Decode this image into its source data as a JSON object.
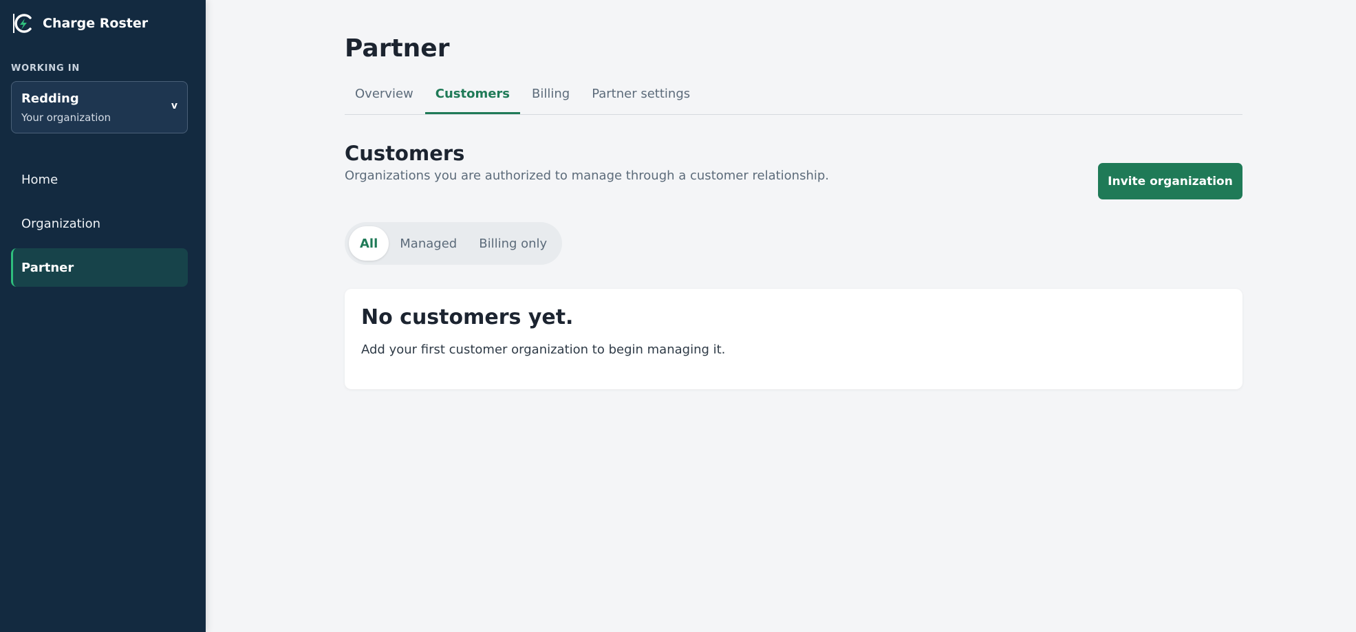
{
  "brand": {
    "name": "Charge Roster",
    "logo_icon": "lightning-bolt-icon",
    "accent_color": "#2fbf7d"
  },
  "sidebar": {
    "working_in_label": "WORKING IN",
    "org_switcher": {
      "name": "Redding",
      "subtitle": "Your organization",
      "chevron": "v"
    },
    "items": [
      {
        "label": "Home",
        "active": false
      },
      {
        "label": "Organization",
        "active": false
      },
      {
        "label": "Partner",
        "active": true
      }
    ]
  },
  "page": {
    "title": "Partner",
    "tabs": [
      {
        "label": "Overview",
        "active": false
      },
      {
        "label": "Customers",
        "active": true
      },
      {
        "label": "Billing",
        "active": false
      },
      {
        "label": "Partner settings",
        "active": false
      }
    ]
  },
  "customers": {
    "title": "Customers",
    "description": "Organizations you are authorized to manage through a customer relationship.",
    "invite_button_label": "Invite organization",
    "filters": [
      {
        "label": "All",
        "active": true
      },
      {
        "label": "Managed",
        "active": false
      },
      {
        "label": "Billing only",
        "active": false
      }
    ],
    "empty_state": {
      "title": "No customers yet.",
      "description": "Add your first customer organization to begin managing it."
    }
  },
  "colors": {
    "sidebar_bg": "#132a40",
    "primary_green": "#1f7a57",
    "page_bg": "#f4f5f7"
  }
}
